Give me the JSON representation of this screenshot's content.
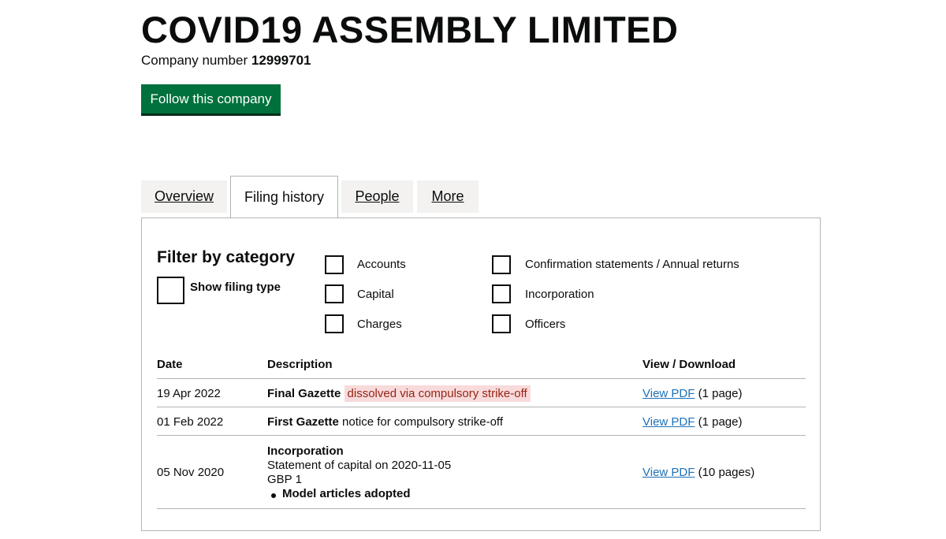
{
  "company": {
    "name": "COVID19 ASSEMBLY LIMITED",
    "number_label": "Company number",
    "number": "12999701",
    "follow_label": "Follow this company"
  },
  "tabs": [
    {
      "label": "Overview",
      "active": false
    },
    {
      "label": "Filing history",
      "active": true
    },
    {
      "label": "People",
      "active": false
    },
    {
      "label": "More",
      "active": false
    }
  ],
  "filter": {
    "heading": "Filter by category",
    "show_filing_type": "Show filing type",
    "categories": [
      "Accounts",
      "Capital",
      "Charges",
      "Confirmation statements / Annual returns",
      "Incorporation",
      "Officers"
    ]
  },
  "table": {
    "headers": {
      "date": "Date",
      "description": "Description",
      "view": "View / Download"
    },
    "rows": [
      {
        "date": "19 Apr 2022",
        "desc_bold": "Final Gazette",
        "desc_rest": "dissolved via compulsory strike-off",
        "link": "View PDF",
        "pages": "(1 page)"
      },
      {
        "date": "01 Feb 2022",
        "desc_bold": "First Gazette",
        "desc_rest": "notice for compulsory strike-off",
        "link": "View PDF",
        "pages": "(1 page)"
      },
      {
        "date": "05 Nov 2020",
        "desc_bold": "Incorporation",
        "desc_line2": "Statement of capital on 2020-11-05",
        "desc_line3": "GBP 1",
        "desc_bullet": "Model articles adopted",
        "link": "View PDF",
        "pages": "(10 pages)"
      }
    ]
  },
  "colors": {
    "button_green": "#00703c",
    "link_blue": "#1d70b8",
    "highlight_bg": "#f8dadb",
    "highlight_text": "#942514"
  }
}
